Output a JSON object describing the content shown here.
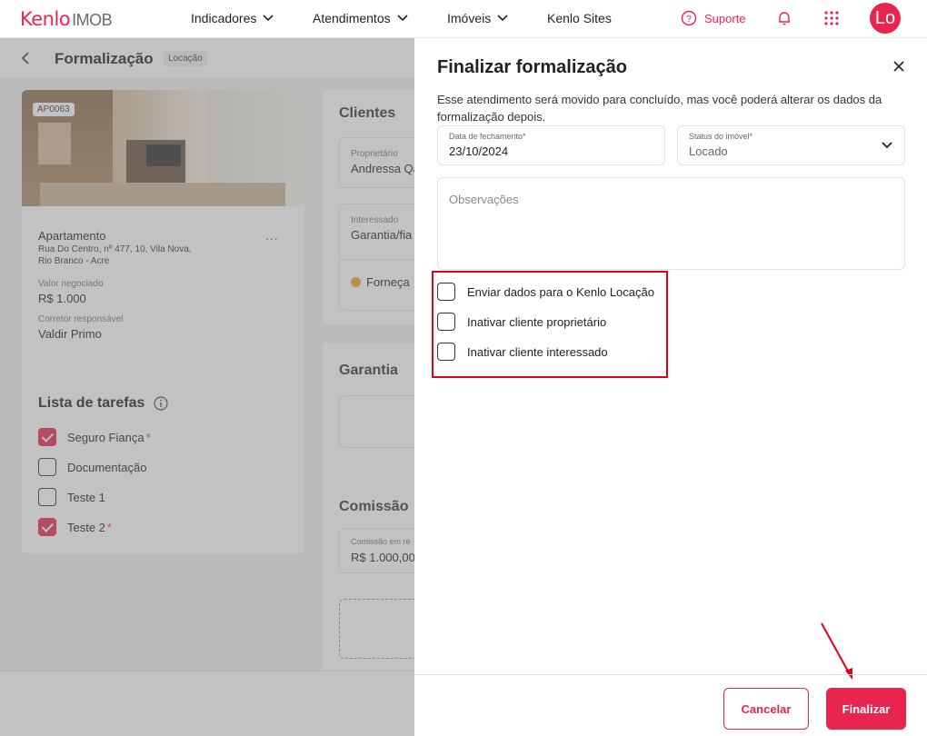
{
  "topnav": {
    "logo_brand": "Kenlo",
    "logo_sub": "IMOB",
    "items": [
      "Indicadores",
      "Atendimentos",
      "Imóveis",
      "Kenlo Sites"
    ],
    "support_label": "Suporte",
    "avatar_initials": "Lo"
  },
  "page": {
    "title": "Formalização",
    "tag": "Locação"
  },
  "property": {
    "code": "AP0063",
    "type": "Apartamento",
    "address": "Rua Do Centro, nº 477, 10, Vila Nova, Rio Branco - Acre",
    "value_label": "Valor negociado",
    "value": "R$ 1.000",
    "broker_label": "Corretor responsável",
    "broker": "Valdir Primo",
    "menu": "..."
  },
  "tasks": {
    "title": "Lista de tarefas",
    "items": [
      {
        "label": "Seguro Fiança",
        "required": "*"
      },
      {
        "label": "Documentação",
        "required": ""
      },
      {
        "label": "Teste 1",
        "required": ""
      },
      {
        "label": "Teste 2",
        "required": "*"
      }
    ]
  },
  "clients": {
    "title": "Clientes",
    "owner_label": "Proprietário",
    "owner": "Andressa Qa",
    "interested_label": "Interessado",
    "interested": "Garantia/fia",
    "provide": "Forneça"
  },
  "guarantee": {
    "title": "Garantia"
  },
  "commission": {
    "title": "Comissão",
    "label": "Comissão em re",
    "value": "R$ 1.000,00"
  },
  "drawer": {
    "title": "Finalizar formalização",
    "description": "Esse atendimento será movido para concluído, mas você poderá alterar os dados da formalização depois.",
    "date_label": "Data de fechamento*",
    "date_value": "23/10/2024",
    "status_label": "Status do imóvel*",
    "status_value": "Locado",
    "notes_placeholder": "Observações",
    "options": [
      "Enviar dados para o Kenlo Locação",
      "Inativar cliente proprietário",
      "Inativar cliente interessado"
    ],
    "cancel_label": "Cancelar",
    "finish_label": "Finalizar"
  },
  "colors": {
    "accent": "#e8254f",
    "highlight": "#e0001b"
  }
}
